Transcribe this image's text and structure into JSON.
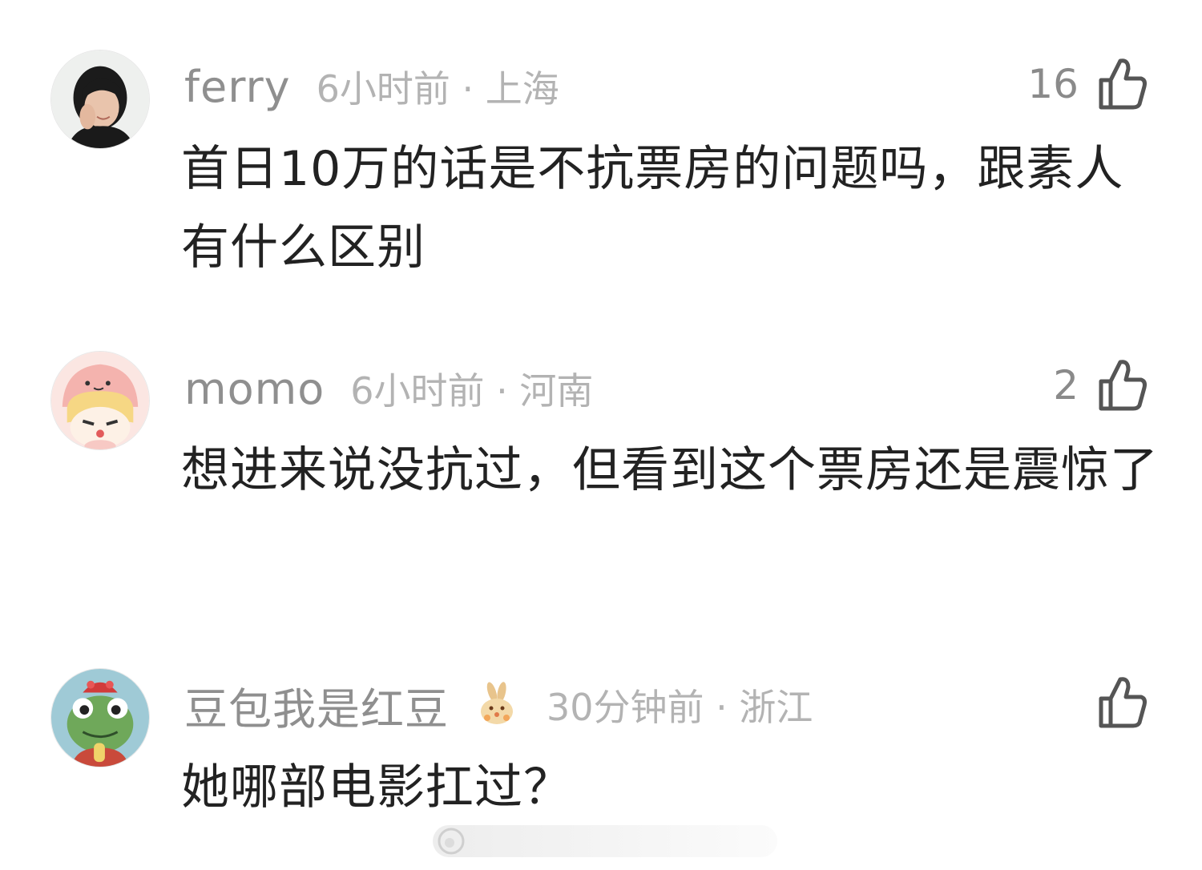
{
  "comments": [
    {
      "username": "ferry",
      "time_location": "6小时前 · 上海",
      "like_count": "16",
      "text": "首日10万的话是不抗票房的问题吗，跟素人有什么区别"
    },
    {
      "username": "momo",
      "time_location": "6小时前 · 河南",
      "like_count": "2",
      "text": "想进来说没抗过，但看到这个票房还是震惊了"
    },
    {
      "username": "豆包我是红豆",
      "badge_icon": "rabbit-badge-icon",
      "time_location": "30分钟前 · 浙江",
      "like_count": "",
      "text": "她哪部电影扛过？"
    }
  ],
  "icons": {
    "like": "thumbs-up-icon",
    "watermark": "weibo-watermark-icon"
  },
  "colors": {
    "username": "#8f8f8f",
    "meta": "#b3b3b3",
    "text": "#222222",
    "icon": "#555555"
  }
}
